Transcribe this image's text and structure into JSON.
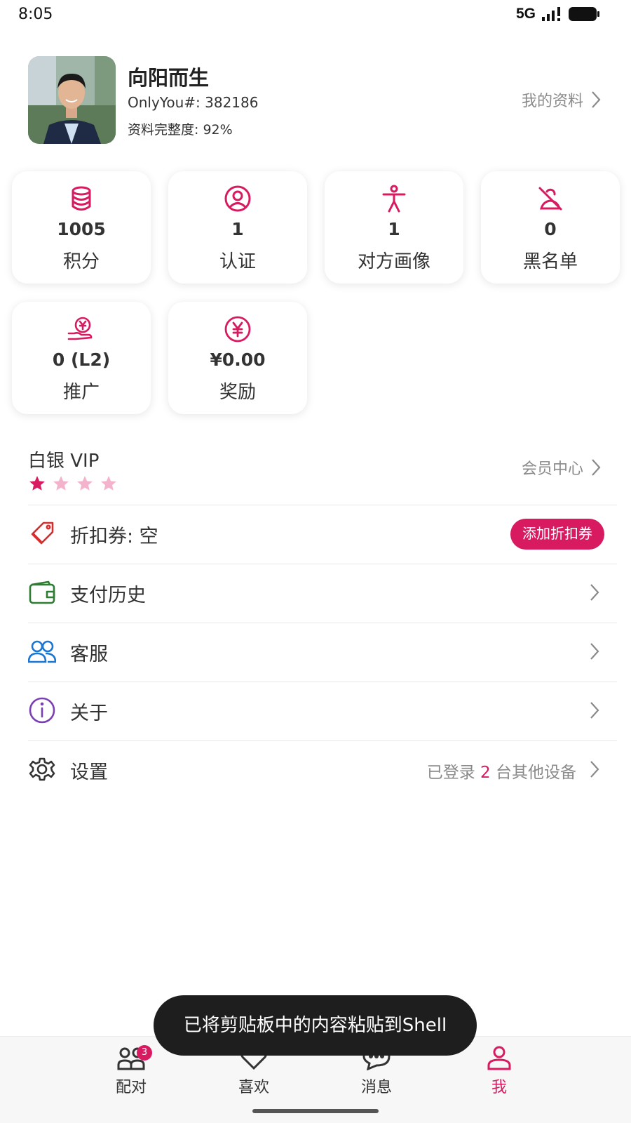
{
  "status_bar": {
    "time": "8:05",
    "network": "5G"
  },
  "profile": {
    "nickname": "向阳而生",
    "user_id": "OnlyYou#: 382186",
    "completeness": "资料完整度: 92%",
    "link_label": "我的资料"
  },
  "stats": [
    {
      "icon": "database-icon",
      "value": "1005",
      "label": "积分"
    },
    {
      "icon": "user-circle-icon",
      "value": "1",
      "label": "认证"
    },
    {
      "icon": "person-figure-icon",
      "value": "1",
      "label": "对方画像"
    },
    {
      "icon": "user-off-icon",
      "value": "0",
      "label": "黑名单"
    },
    {
      "icon": "hand-coin-icon",
      "value": "0 (L2)",
      "label": "推广"
    },
    {
      "icon": "yen-circle-icon",
      "value": "¥0.00",
      "label": "奖励"
    }
  ],
  "vip": {
    "title": "白银 VIP",
    "stars_total": 4,
    "stars_filled": 1,
    "link_label": "会员中心"
  },
  "menu": {
    "coupon": {
      "label": "折扣券: 空",
      "button": "添加折扣券"
    },
    "payment": {
      "label": "支付历史"
    },
    "support": {
      "label": "客服"
    },
    "about": {
      "label": "关于"
    },
    "settings": {
      "label": "设置",
      "right_prefix": "已登录 ",
      "right_count": "2",
      "right_suffix": " 台其他设备"
    }
  },
  "toast": "已将剪贴板中的内容粘贴到Shell",
  "bottom_nav": [
    {
      "label": "配对",
      "badge": "3"
    },
    {
      "label": "喜欢"
    },
    {
      "label": "消息"
    },
    {
      "label": "我",
      "active": true
    }
  ],
  "colors": {
    "accent": "#d81b60",
    "star_empty": "#f4b3cc",
    "wallet": "#2e7d32",
    "support": "#1976d2",
    "about": "#7b3fb3",
    "coupon_icon": "#d32f2f"
  }
}
